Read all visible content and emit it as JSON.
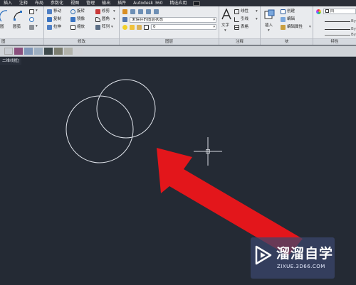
{
  "menu": {
    "items": [
      {
        "label": "插入"
      },
      {
        "label": "注释"
      },
      {
        "label": "布局"
      },
      {
        "label": "参数化"
      },
      {
        "label": "视图"
      },
      {
        "label": "管理"
      },
      {
        "label": "输出"
      },
      {
        "label": "插件"
      },
      {
        "label": "Autodesk 360"
      },
      {
        "label": "精选应用"
      }
    ]
  },
  "ribbon": {
    "draw": {
      "circle_label": "圆",
      "arc_label": "圆弧"
    },
    "modify": {
      "title": "修改",
      "move": "移动",
      "rotate": "旋转",
      "trim": "修剪",
      "copy": "复制",
      "mirror": "镜像",
      "fillet": "圆角",
      "stretch": "拉伸",
      "scale": "缩放",
      "array": "阵列"
    },
    "layers": {
      "title": "图层",
      "layer_state": "未保存的图层状态",
      "current_layer": "0"
    },
    "annotation": {
      "title": "注释",
      "text": "文字",
      "dimension": "线性",
      "leader": "引线",
      "table": "表格"
    },
    "block": {
      "title": "块",
      "insert": "插入",
      "create": "创建",
      "edit": "编辑",
      "edit_attributes": "编辑属性"
    },
    "properties": {
      "title": "特性",
      "color": "白",
      "bylayer1": "By",
      "bylayer2": "By",
      "bylayer3": "By"
    },
    "left_title": "图"
  },
  "viewport_label": "二维线框]",
  "colors": {
    "canvas": "#242a34",
    "arrow": "#e3161b",
    "circle": "#dfe3ea"
  },
  "watermark": {
    "text": "溜溜自学",
    "url": "ZIXUE.3D66.COM"
  }
}
